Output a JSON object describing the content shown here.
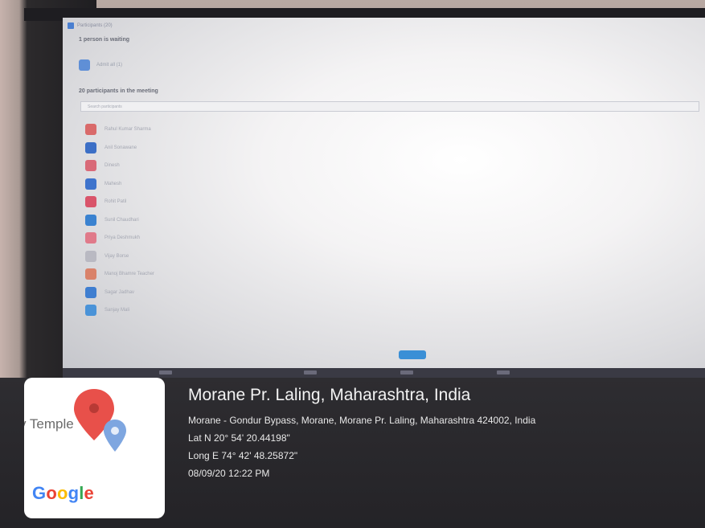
{
  "meeting_panel": {
    "window_title": "Participants (20)",
    "host_section_label": "1 person is waiting",
    "host_name": "Admit all (1)",
    "participants_label": "20 participants in the meeting",
    "search_placeholder": "Search participants",
    "participants": [
      {
        "name": "Rahul Kumar Sharma",
        "color": "#d96a6a"
      },
      {
        "name": "Anil Sonawane",
        "color": "#3c6fc6"
      },
      {
        "name": "Dinesh",
        "color": "#d96a78"
      },
      {
        "name": "Mahesh",
        "color": "#3e73cc"
      },
      {
        "name": "Rohit Patil",
        "color": "#d9546a"
      },
      {
        "name": "Sunil Chaudhari",
        "color": "#3a82d0"
      },
      {
        "name": "Priya Deshmukh",
        "color": "#e07a8a"
      },
      {
        "name": "Vijay Borse",
        "color": "#b9b9c2"
      },
      {
        "name": "Manoj Bhamre Teacher",
        "color": "#d9826a"
      },
      {
        "name": "Sagar Jadhav",
        "color": "#3f7ed0"
      },
      {
        "name": "Sanjay Mali",
        "color": "#4a93d8"
      }
    ]
  },
  "map_card": {
    "place_text": "v Temple",
    "google_letters": [
      {
        "ch": "G",
        "color": "#4285f4"
      },
      {
        "ch": "o",
        "color": "#ea4335"
      },
      {
        "ch": "o",
        "color": "#fbbc05"
      },
      {
        "ch": "g",
        "color": "#4285f4"
      },
      {
        "ch": "l",
        "color": "#34a853"
      },
      {
        "ch": "e",
        "color": "#ea4335"
      }
    ]
  },
  "geo": {
    "title": "Morane Pr. Laling, Maharashtra, India",
    "address": "Morane - Gondur Bypass, Morane, Morane Pr. Laling, Maharashtra 424002, India",
    "lat": "Lat N 20° 54' 20.44198\"",
    "long": "Long E 74° 42' 48.25872\"",
    "datetime": "08/09/20 12:22 PM"
  }
}
